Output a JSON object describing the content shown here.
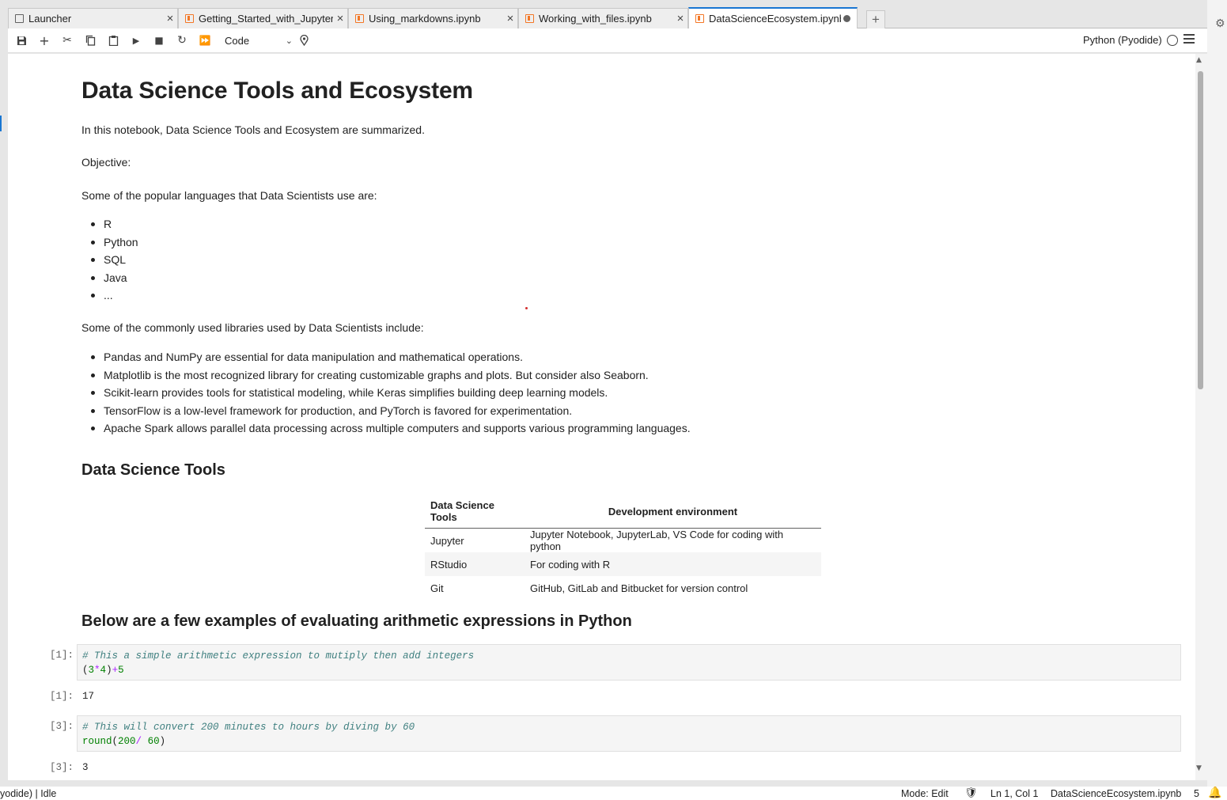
{
  "tabs": [
    {
      "label": "Launcher",
      "type": "launcher"
    },
    {
      "label": "Getting_Started_with_Jupyter",
      "type": "notebook"
    },
    {
      "label": "Using_markdowns.ipynb",
      "type": "notebook"
    },
    {
      "label": "Working_with_files.ipynb",
      "type": "notebook"
    },
    {
      "label": "DataScienceEcosystem.ipynb",
      "type": "notebook",
      "active": true,
      "unsaved": true
    }
  ],
  "toolbar": {
    "cell_type": "Code",
    "kernel_name": "Python (Pyodide)",
    "icons": [
      "save-icon",
      "add-cell-icon",
      "cut-icon",
      "copy-icon",
      "paste-icon",
      "run-icon",
      "stop-icon",
      "restart-icon",
      "fast-forward-icon"
    ]
  },
  "notebook": {
    "title": "Data Science Tools and Ecosystem",
    "intro": "In this notebook, Data Science Tools and Ecosystem are summarized.",
    "objective": "Objective:",
    "languages_intro": "Some of the popular languages that Data Scientists use are:",
    "languages": [
      "R",
      "Python",
      "SQL",
      "Java",
      "..."
    ],
    "libraries_intro": "Some of the commonly used libraries used by Data Scientists include:",
    "libraries": [
      "Pandas and NumPy are essential for data manipulation and mathematical operations.",
      "Matplotlib is the most recognized library for creating customizable graphs and plots. But consider also Seaborn.",
      "Scikit-learn provides tools for statistical modeling, while Keras simplifies building deep learning models.",
      "TensorFlow is a low-level framework for production, and PyTorch is favored for experimentation.",
      "Apache Spark allows parallel data processing across multiple computers and supports various programming languages."
    ],
    "tools_heading": "Data Science Tools",
    "tools_table": {
      "headers": [
        "Data Science Tools",
        "Development environment"
      ],
      "rows": [
        [
          "Jupyter",
          "Jupyter Notebook, JupyterLab, VS Code for coding with python"
        ],
        [
          "RStudio",
          "For coding with R"
        ],
        [
          "Git",
          "GitHub, GitLab and Bitbucket for version control"
        ]
      ]
    },
    "examples_heading": "Below are a few examples of evaluating arithmetic expressions in Python",
    "cells": [
      {
        "prompt": "[1]:",
        "comment": "#  This a simple arithmetic expression to mutiply then add integers",
        "code": {
          "p1": "(",
          "n1": "3",
          "op1": "*",
          "n2": "4",
          "p2": ")",
          "op2": "+",
          "n3": "5"
        },
        "output_prompt": "[1]:",
        "output": "17"
      },
      {
        "prompt": "[3]:",
        "comment": "# This will convert 200 minutes to hours by diving by 60",
        "code": {
          "fn": "round",
          "p1": "(",
          "n1": "200",
          "op1": "/",
          "n2": " 60",
          "p2": ")"
        },
        "output_prompt": "[3]:",
        "output": "3"
      }
    ]
  },
  "status": {
    "kernel": "yodide) | Idle",
    "mode": "Mode: Edit",
    "position": "Ln 1, Col 1",
    "filename": "DataScienceEcosystem.ipynb",
    "count": "5"
  },
  "colors": {
    "accent": "#1976d2",
    "notebook_icon": "#f37726",
    "comment": "#408080",
    "number": "#008000",
    "operator": "#aa22ff"
  }
}
